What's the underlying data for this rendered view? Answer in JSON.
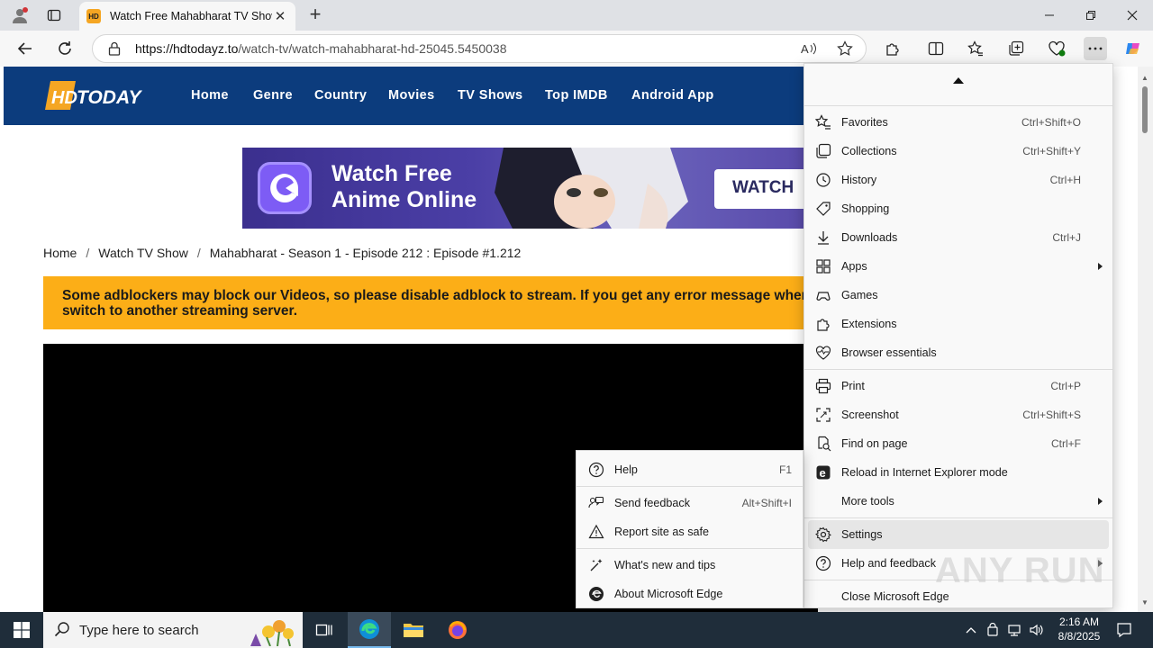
{
  "browser": {
    "tab_title": "Watch Free Mahabharat TV Show",
    "tab_favicon_text": "HD",
    "url_domain": "https://hdtodayz.to",
    "url_path": "/watch-tv/watch-mahabharat-hd-25045.5450038"
  },
  "site": {
    "logo_text": "HD TODAY",
    "nav": [
      "Home",
      "Genre",
      "Country",
      "Movies",
      "TV Shows",
      "Top IMDB",
      "Android App"
    ],
    "banner": {
      "line1": "Watch Free",
      "line2": "Anime Online",
      "button": "WATCH"
    },
    "breadcrumb": [
      "Home",
      "Watch TV Show",
      "Mahabharat - Season 1 - Episode 212 : Episode #1.212"
    ],
    "breadcrumb_sep": "/",
    "warning_line1": "Some adblockers may block our Videos, so please disable adblock to stream. If you get any error message when tr",
    "warning_line2": "switch to another streaming server."
  },
  "menu": {
    "items": [
      {
        "label": "Favorites",
        "shortcut": "Ctrl+Shift+O",
        "icon": "favorites-icon"
      },
      {
        "label": "Collections",
        "shortcut": "Ctrl+Shift+Y",
        "icon": "collections-icon"
      },
      {
        "label": "History",
        "shortcut": "Ctrl+H",
        "icon": "history-icon"
      },
      {
        "label": "Shopping",
        "shortcut": "",
        "icon": "shopping-tag-icon"
      },
      {
        "label": "Downloads",
        "shortcut": "Ctrl+J",
        "icon": "download-icon"
      },
      {
        "label": "Apps",
        "shortcut": "",
        "icon": "apps-icon"
      },
      {
        "label": "Games",
        "shortcut": "",
        "icon": "games-icon"
      },
      {
        "label": "Extensions",
        "shortcut": "",
        "icon": "extensions-icon"
      },
      {
        "label": "Browser essentials",
        "shortcut": "",
        "icon": "heart-pulse-icon"
      },
      {
        "label": "Print",
        "shortcut": "Ctrl+P",
        "icon": "print-icon"
      },
      {
        "label": "Screenshot",
        "shortcut": "Ctrl+Shift+S",
        "icon": "screenshot-icon"
      },
      {
        "label": "Find on page",
        "shortcut": "Ctrl+F",
        "icon": "find-icon"
      },
      {
        "label": "Reload in Internet Explorer mode",
        "shortcut": "",
        "icon": "ie-mode-icon"
      },
      {
        "label": "More tools",
        "shortcut": "",
        "icon": ""
      },
      {
        "label": "Settings",
        "shortcut": "",
        "icon": "gear-icon"
      },
      {
        "label": "Help and feedback",
        "shortcut": "",
        "icon": "help-icon"
      },
      {
        "label": "Close Microsoft Edge",
        "shortcut": "",
        "icon": ""
      }
    ]
  },
  "submenu": {
    "items": [
      {
        "label": "Help",
        "shortcut": "F1"
      },
      {
        "label": "Send feedback",
        "shortcut": "Alt+Shift+I"
      },
      {
        "label": "Report site as safe",
        "shortcut": ""
      },
      {
        "label": "What's new and tips",
        "shortcut": ""
      },
      {
        "label": "About Microsoft Edge",
        "shortcut": ""
      }
    ]
  },
  "watermark": "ANY RUN",
  "taskbar": {
    "search_placeholder": "Type here to search",
    "time": "2:16 AM",
    "date": "8/8/2025"
  },
  "colors": {
    "site_nav": "#0c3c7d",
    "warning": "#fcae17",
    "accent": "#0078d4"
  }
}
